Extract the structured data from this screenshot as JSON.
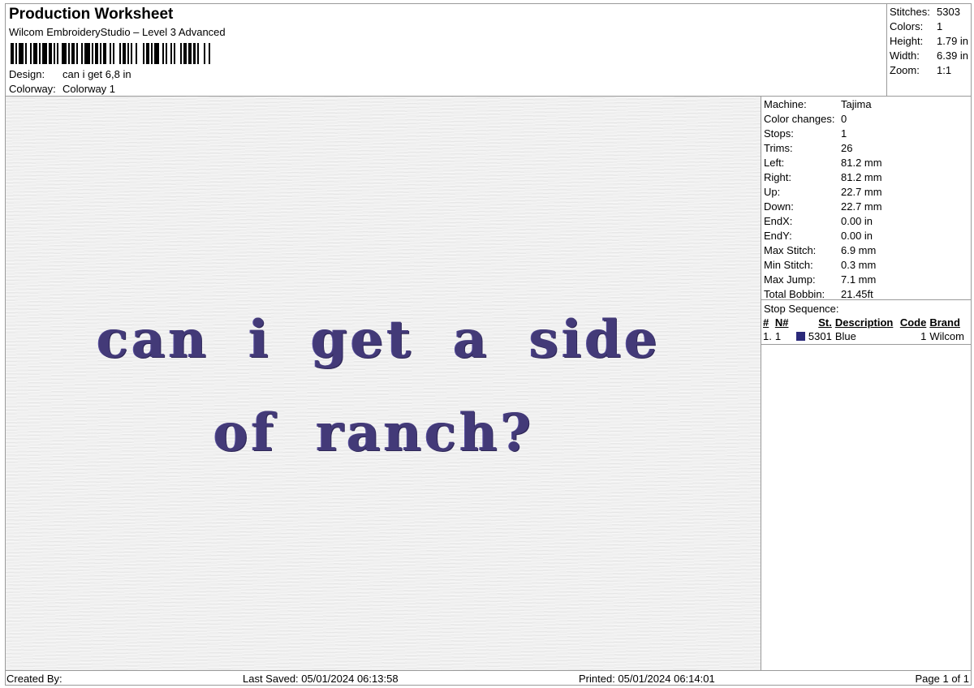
{
  "header": {
    "title": "Production Worksheet",
    "subtitle": "Wilcom EmbroideryStudio – Level 3 Advanced",
    "design_label": "Design:",
    "design_value": "can i get 6,8 in",
    "colorway_label": "Colorway:",
    "colorway_value": "Colorway 1"
  },
  "summary": [
    {
      "label": "Stitches:",
      "value": "5303"
    },
    {
      "label": "Colors:",
      "value": "1"
    },
    {
      "label": "Height:",
      "value": "1.79 in"
    },
    {
      "label": "Width:",
      "value": "6.39 in"
    },
    {
      "label": "Zoom:",
      "value": "1:1"
    }
  ],
  "design_text": {
    "line1": "can i get a side",
    "line2": "of ranch?"
  },
  "machine_info": [
    {
      "label": "Machine:",
      "value": "Tajima"
    },
    {
      "label": "Color changes:",
      "value": "0"
    },
    {
      "label": "Stops:",
      "value": "1"
    },
    {
      "label": "Trims:",
      "value": "26"
    },
    {
      "label": "Left:",
      "value": "81.2 mm"
    },
    {
      "label": "Right:",
      "value": "81.2 mm"
    },
    {
      "label": "Up:",
      "value": "22.7 mm"
    },
    {
      "label": "Down:",
      "value": "22.7 mm"
    },
    {
      "label": "EndX:",
      "value": "0.00 in"
    },
    {
      "label": "EndY:",
      "value": "0.00 in"
    },
    {
      "label": "Max Stitch:",
      "value": "6.9 mm"
    },
    {
      "label": "Min Stitch:",
      "value": "0.3 mm"
    },
    {
      "label": "Max Jump:",
      "value": "7.1 mm"
    },
    {
      "label": "Total Bobbin:",
      "value": "21.45ft"
    }
  ],
  "stop_sequence": {
    "title": "Stop Sequence:",
    "columns": [
      "#",
      "N#",
      "St.",
      "Description",
      "Code",
      "Brand"
    ],
    "rows": [
      {
        "num": "1.",
        "n": "1",
        "color": "#2b2a7a",
        "st": "5301",
        "description": "Blue",
        "code": "1",
        "brand": "Wilcom"
      }
    ]
  },
  "footer": {
    "created_by": "Created By:",
    "last_saved": "Last Saved: 05/01/2024 06:13:58",
    "printed": "Printed: 05/01/2024 06:14:01",
    "page": "Page 1 of 1"
  },
  "colors": {
    "thread": "#433a78"
  }
}
